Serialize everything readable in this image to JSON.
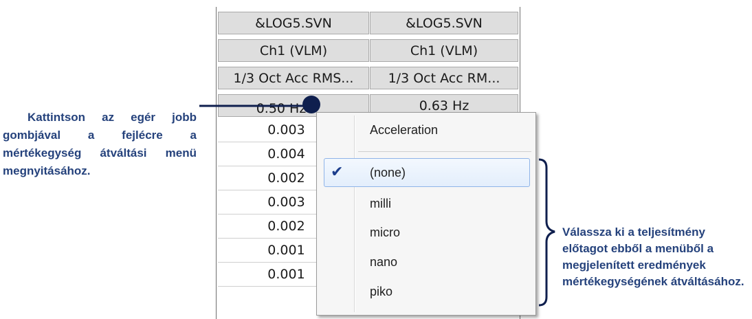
{
  "columns": [
    {
      "file": "&LOG5.SVN",
      "channel": "Ch1 (VLM)",
      "measurement": "1/3 Oct Acc RMS...",
      "frequency": "0.50 Hz",
      "values": [
        "0.003",
        "0.004",
        "0.002",
        "0.003",
        "0.002",
        "0.001",
        "0.001"
      ]
    },
    {
      "file": "&LOG5.SVN",
      "channel": "Ch1 (VLM)",
      "measurement": "1/3 Oct Acc RM...",
      "frequency": "0.63 Hz"
    }
  ],
  "context_menu": {
    "title": "Acceleration",
    "items": [
      "(none)",
      "milli",
      "micro",
      "nano",
      "piko"
    ],
    "selected": "(none)"
  },
  "annotations": {
    "left": "Kattintson az egér jobb gombjával a fejlécre a mértékegység átváltási menü megnyitásához.",
    "right": "Válassza ki a teljesítmény előtagot ebből a menüből a megjelenített eredmények mértékegységének átváltásához."
  },
  "colors": {
    "annotation_text": "#25427c",
    "header_bg": "#dedede",
    "menu_highlight_border": "#8fb4e8",
    "marker": "#0f1f4e"
  }
}
